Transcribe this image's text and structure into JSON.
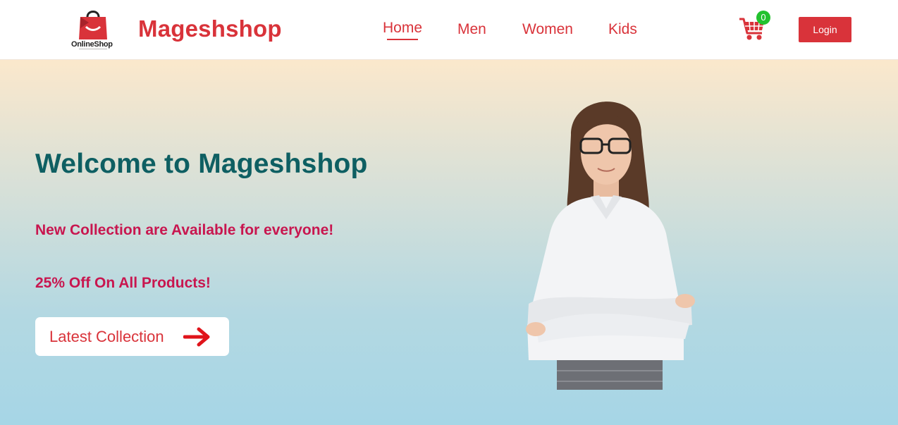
{
  "header": {
    "logo_caption": "OnlineShop",
    "brand": "Mageshshop",
    "nav": [
      {
        "label": "Home",
        "active": true
      },
      {
        "label": "Men",
        "active": false
      },
      {
        "label": "Women",
        "active": false
      },
      {
        "label": "Kids",
        "active": false
      }
    ],
    "cart": {
      "icon": "shopping-cart-icon",
      "count": "0"
    },
    "login_label": "Login"
  },
  "hero": {
    "title": "Welcome to Mageshshop",
    "subtitle_1": "New Collection are Available for everyone!",
    "subtitle_2": "25% Off On All Products!",
    "cta_label": "Latest Collection",
    "cta_icon": "arrow-right-icon",
    "image": "woman-in-white-shirt-with-glasses"
  },
  "colors": {
    "brand_red": "#d9333a",
    "title_teal": "#0e5f62",
    "accent_magenta": "#c8164f",
    "badge_green": "#22c22e",
    "gradient_top": "#fbe8cc",
    "gradient_bottom": "#a6d6e6"
  }
}
